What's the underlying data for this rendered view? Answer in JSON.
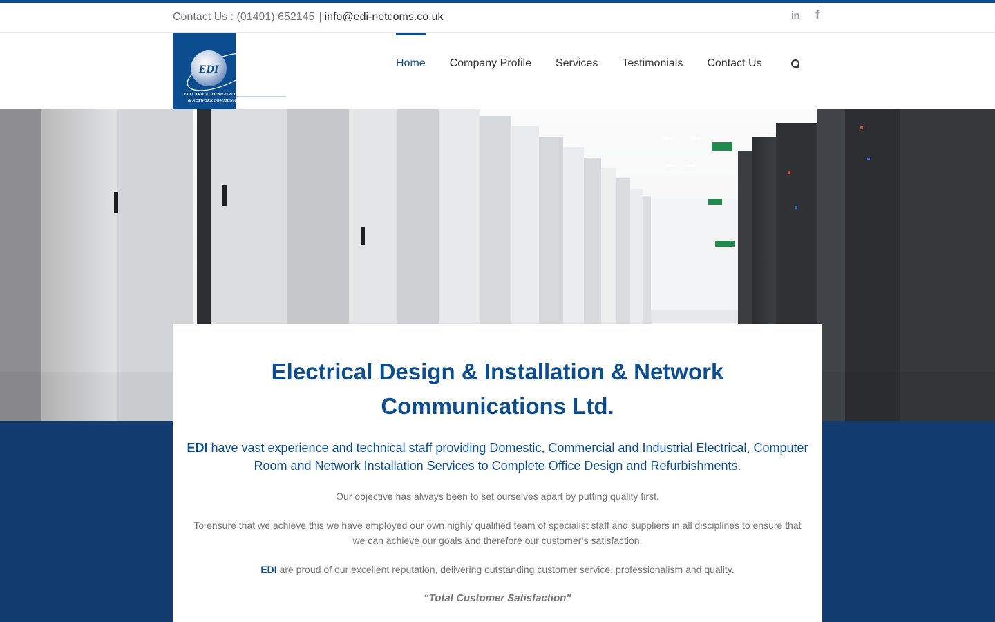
{
  "topbar": {
    "contact_label": "Contact Us : (01491) 652145",
    "separator": "|",
    "email": "info@edi-netcoms.co.uk",
    "social": [
      {
        "icon": "linkedin-icon",
        "glyph": "in"
      },
      {
        "icon": "facebook-icon",
        "glyph": "f"
      }
    ]
  },
  "logo": {
    "mark": "EDI",
    "line1": "ELECTRICAL DESIGN & INSTALLATION",
    "line2": "& NETWORK COMMUNICATIONS LIMITED"
  },
  "nav": {
    "items": [
      {
        "label": "Home",
        "active": true
      },
      {
        "label": "Company Profile"
      },
      {
        "label": "Services"
      },
      {
        "label": "Testimonials"
      },
      {
        "label": "Contact Us"
      }
    ]
  },
  "content": {
    "title": "Electrical Design & Installation & Network Communications Ltd.",
    "lead_strong": "EDI",
    "lead_text": " have vast experience and technical staff providing Domestic, Commercial and Industrial Electrical, Computer Room and Network Installation Services to Complete Office Design and Refurbishments.",
    "p1": "Our objective has always been to set ourselves apart by putting quality first.",
    "p2": "To ensure that we achieve this we have employed our own highly qualified team of specialist staff and suppliers in all disciplines to ensure that we can achieve our goals and therefore our customer’s satisfaction.",
    "p3_strong": "EDI",
    "p3_text": " are proud of our excellent reputation, delivering outstanding customer service, professionalism and quality.",
    "p4": "“Total Customer Satisfaction”"
  },
  "colors": {
    "brand_blue": "#0b4d8f",
    "band_navy": "#123b70",
    "body_text": "#747474"
  }
}
